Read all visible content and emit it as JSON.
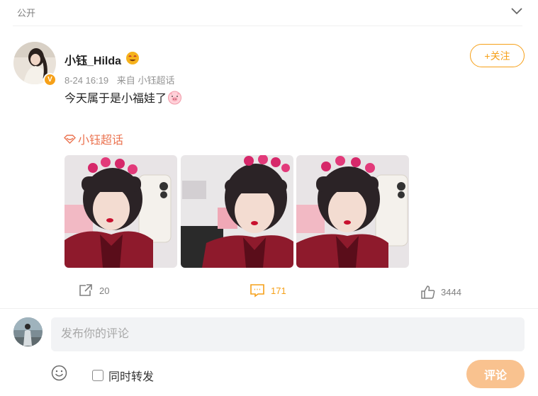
{
  "header": {
    "visibility_label": "公开"
  },
  "post": {
    "author": "小钰_Hilda",
    "verified_badge": "V",
    "date": "8-24 16:19",
    "source_prefix": "来自",
    "source": "小钰超话",
    "follow_label": "+关注",
    "text": "今天属于是小福娃了",
    "topic_label": "小钰超话",
    "photos": [
      "photo-1",
      "photo-2",
      "photo-3"
    ]
  },
  "actions": {
    "repost_count": "20",
    "comment_count": "171",
    "like_count": "3444"
  },
  "composer": {
    "placeholder": "发布你的评论",
    "repost_label": "同时转发",
    "submit_label": "评论"
  },
  "colors": {
    "accent": "#f6a018",
    "topic": "#eb7350",
    "submit_bg": "#f9c28f"
  },
  "icons": [
    "chevron-down-icon",
    "emoji-badge-icon",
    "pig-icon",
    "diamond-icon",
    "repost-icon",
    "comment-icon",
    "like-icon",
    "smile-icon"
  ]
}
